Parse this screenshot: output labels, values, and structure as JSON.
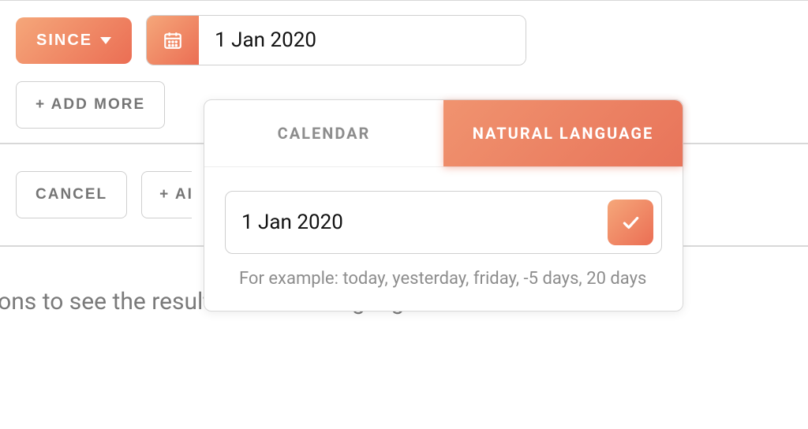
{
  "filter": {
    "since_label": "SINCE",
    "date_value": "1 Jan 2020",
    "add_more_label": "+ ADD MORE"
  },
  "actions": {
    "cancel_label": "CANCEL",
    "truncated_label": "+ AI"
  },
  "popup": {
    "tab_calendar": "CALENDAR",
    "tab_nl": "NATURAL LANGUAGE",
    "nl_value": "1 Jan 2020",
    "hint": "For example: today, yesterday, friday, -5 days, 20 days"
  },
  "background_text": "tions to see the result in natural language."
}
